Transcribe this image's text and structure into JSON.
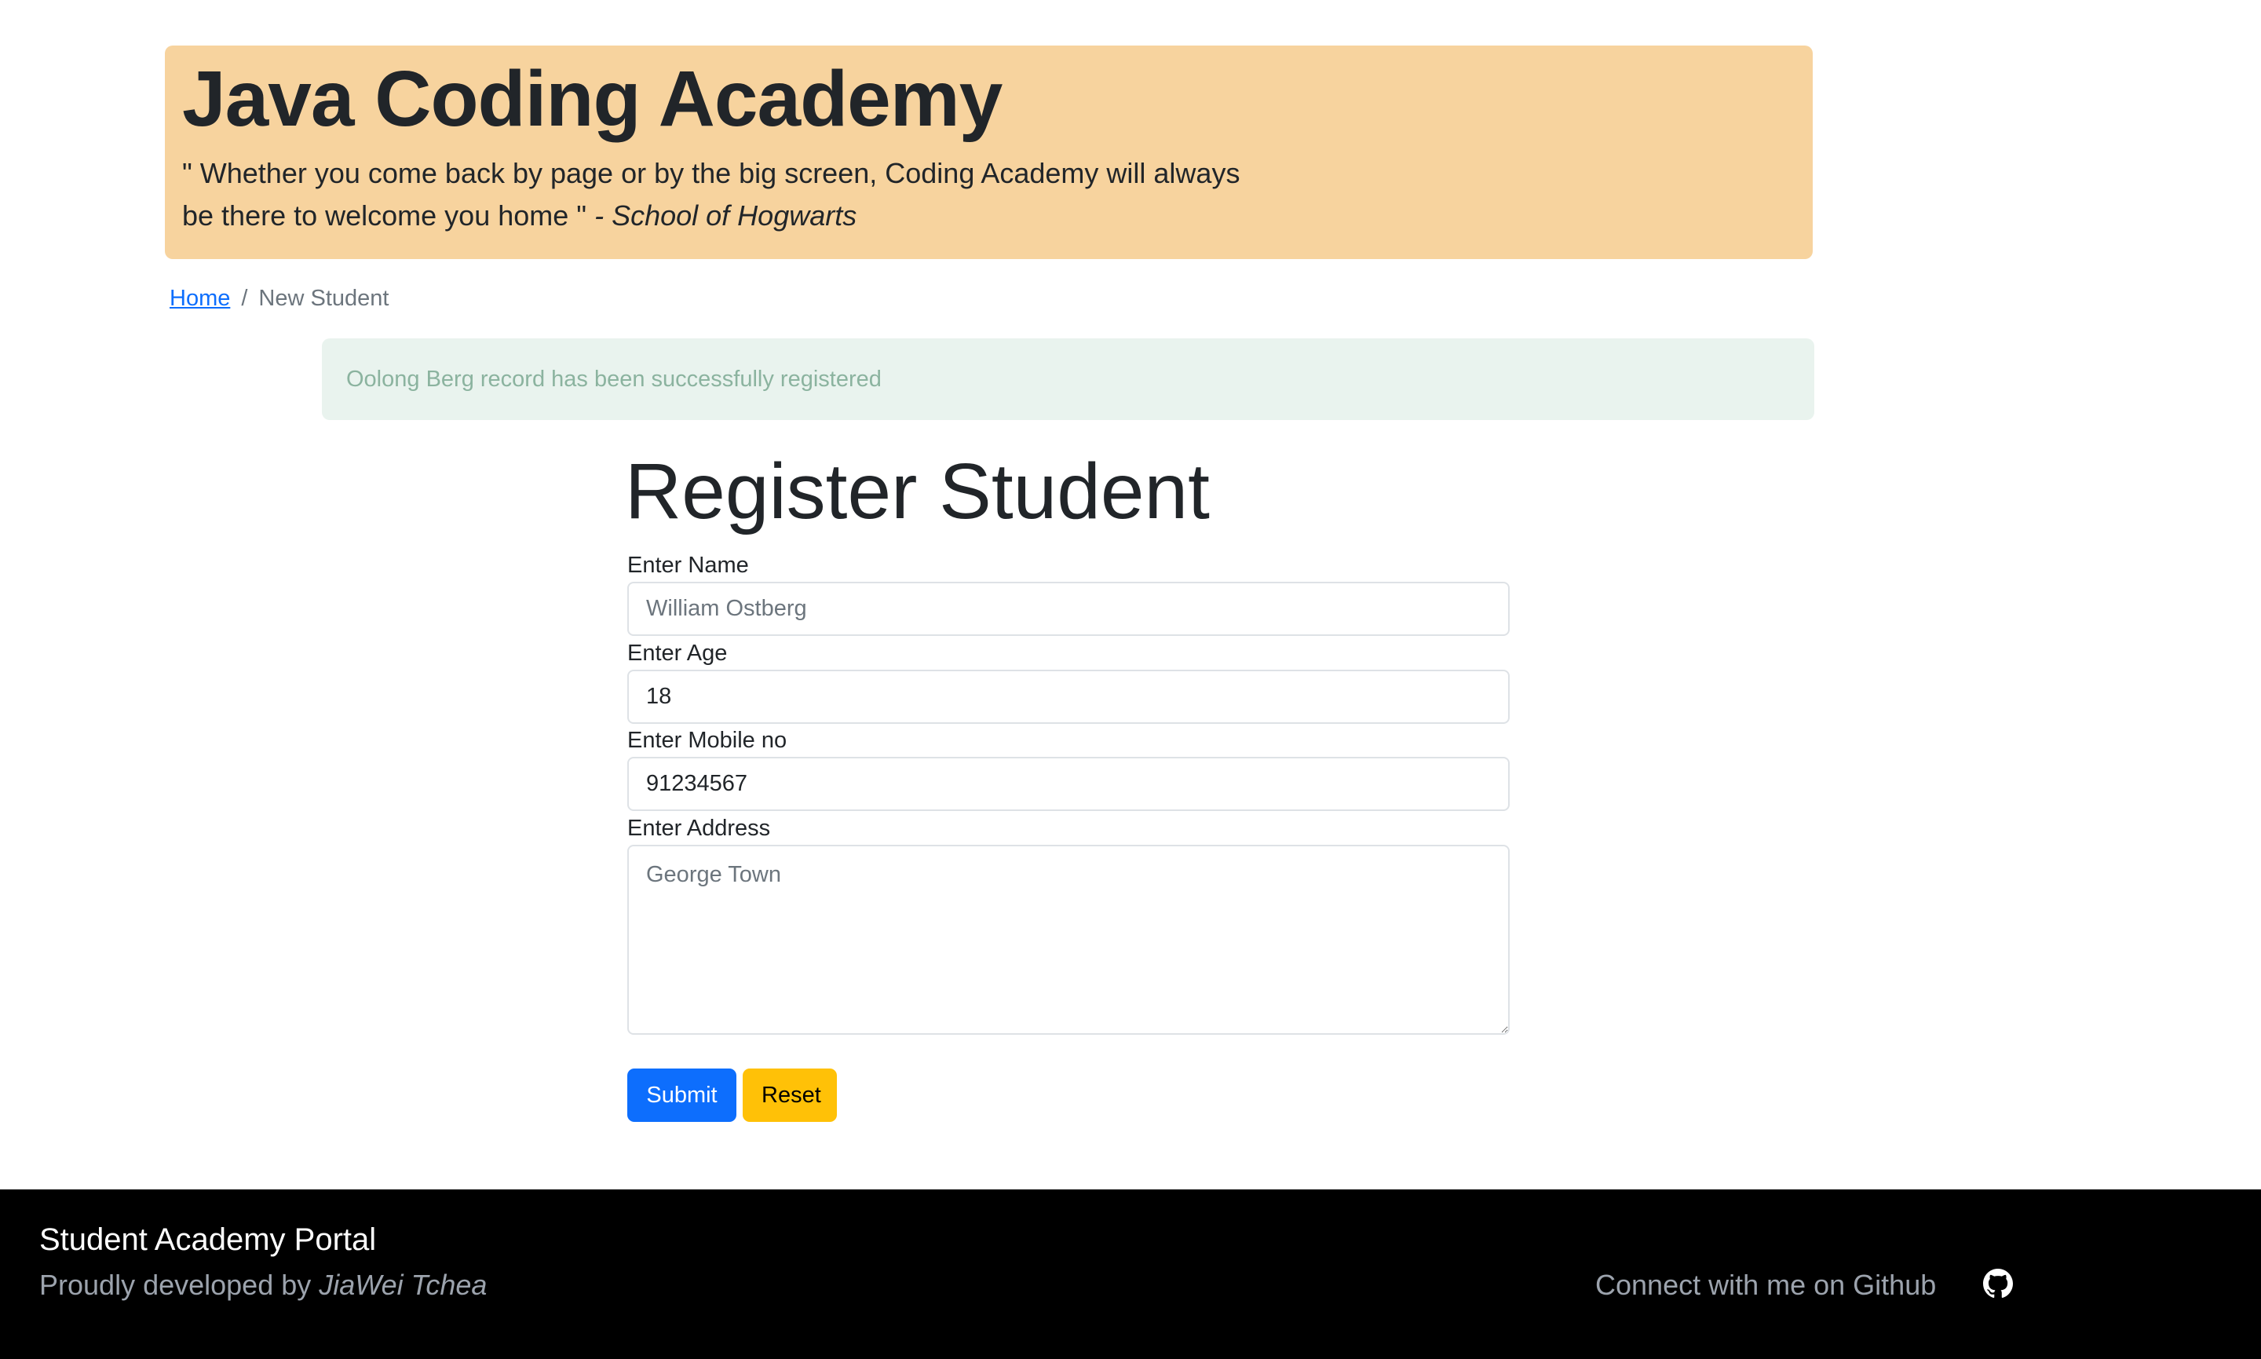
{
  "header": {
    "title": "Java Coding Academy",
    "quote": "\" Whether you come back by page or by the big screen, Coding Academy will always be there to welcome you home \"",
    "quote_source": "- School of Hogwarts"
  },
  "breadcrumb": {
    "home": "Home",
    "separator": "/",
    "current": "New Student"
  },
  "alert": {
    "message": "Oolong Berg record has been successfully registered"
  },
  "form": {
    "title": "Register Student",
    "name_label": "Enter Name",
    "name_placeholder": "William Ostberg",
    "name_value": "",
    "age_label": "Enter Age",
    "age_value": "18",
    "mobile_label": "Enter Mobile no",
    "mobile_value": "91234567",
    "address_label": "Enter Address",
    "address_placeholder": "George Town",
    "submit_label": "Submit",
    "reset_label": "Reset"
  },
  "footer": {
    "title": "Student Academy Portal",
    "credit_prefix": "Proudly developed by",
    "credit_author": "JiaWei Tchea",
    "github_text": "Connect with me on Github",
    "github_icon": "github-icon"
  },
  "colors": {
    "hero_bg": "#f7d39e",
    "alert_bg": "#e9f3ee",
    "alert_text": "#8bb39f",
    "primary": "#0d6efd",
    "warning": "#ffc107",
    "footer_bg": "#000000"
  }
}
